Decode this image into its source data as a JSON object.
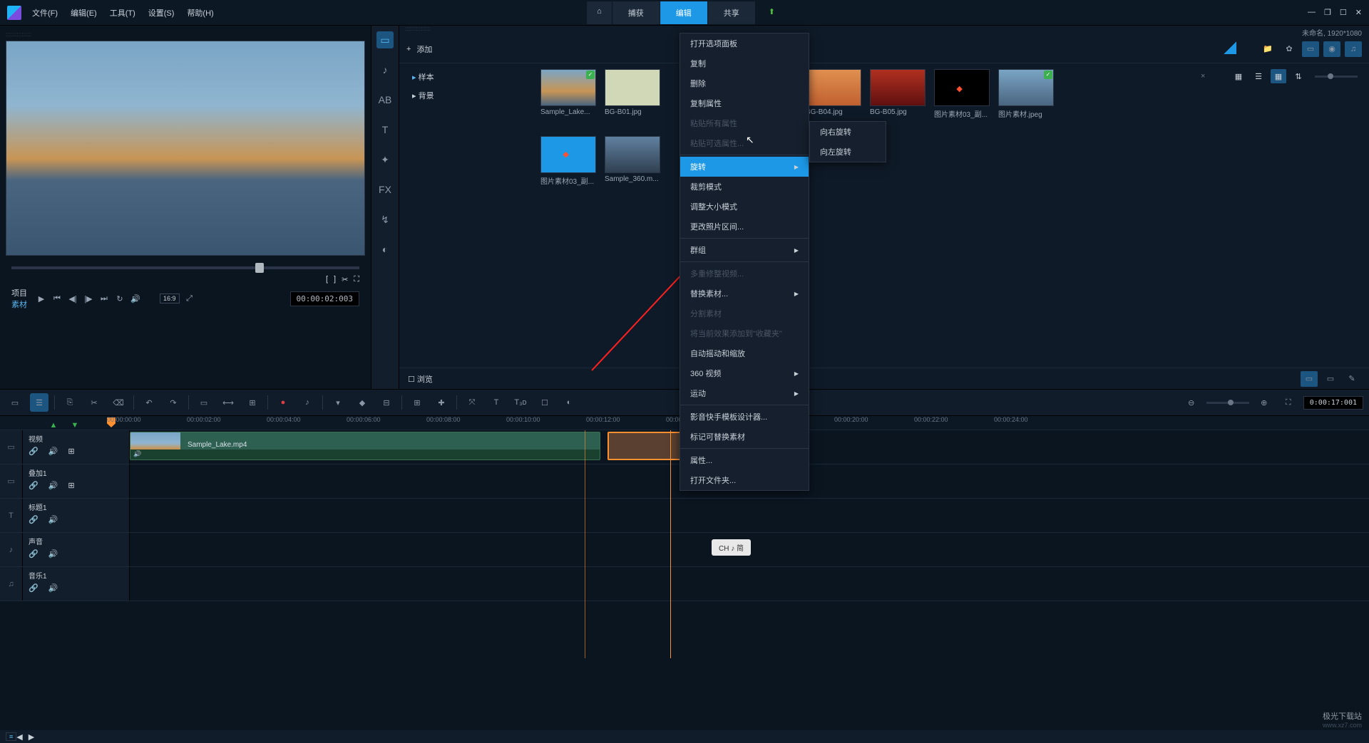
{
  "menubar": {
    "file": "文件(F)",
    "edit": "编辑(E)",
    "tools": "工具(T)",
    "settings": "设置(S)",
    "help": "帮助(H)"
  },
  "top_tabs": {
    "home": "⌂",
    "capture": "捕获",
    "edit": "编辑",
    "share": "共享"
  },
  "project_status": "未命名, 1920*1080",
  "preview": {
    "proj_label": "项目",
    "mat_label": "素材",
    "timecode": "00:00:02:003",
    "aspect": "16:9"
  },
  "library": {
    "add": "添加",
    "tree": {
      "sample": "样本",
      "bg": "背景"
    },
    "thumbs": [
      {
        "label": "Sample_Lake..."
      },
      {
        "label": "BG-B01.jpg"
      },
      {
        "label": "BG-B04.jpg"
      },
      {
        "label": "BG-B05.jpg"
      },
      {
        "label": "图片素材03_副..."
      },
      {
        "label": "图片素材.jpeg"
      },
      {
        "label": "图片素材03_副..."
      },
      {
        "label": "Sample_360.m..."
      }
    ],
    "browse": "浏览"
  },
  "context_menu": [
    {
      "label": "打开选项面板"
    },
    {
      "label": "复制"
    },
    {
      "label": "删除"
    },
    {
      "label": "复制属性"
    },
    {
      "label": "粘贴所有属性",
      "disabled": true
    },
    {
      "label": "粘贴可选属性...",
      "disabled": true
    },
    {
      "sep": true
    },
    {
      "label": "旋转",
      "arrow": true,
      "highlighted": true
    },
    {
      "label": "裁剪模式"
    },
    {
      "label": "调整大小模式"
    },
    {
      "label": "更改照片区间..."
    },
    {
      "sep": true
    },
    {
      "label": "群组",
      "arrow": true
    },
    {
      "sep": true
    },
    {
      "label": "多重修整视频...",
      "disabled": true
    },
    {
      "label": "替换素材...",
      "arrow": true
    },
    {
      "label": "分割素材",
      "disabled": true
    },
    {
      "label": "将当前效果添加到\"收藏夹\"",
      "disabled": true
    },
    {
      "label": "自动摇动和缩放"
    },
    {
      "label": "360 视频",
      "arrow": true
    },
    {
      "label": "运动",
      "arrow": true
    },
    {
      "sep": true
    },
    {
      "label": "影音快手模板设计器..."
    },
    {
      "label": "标记可替换素材"
    },
    {
      "sep": true
    },
    {
      "label": "属性..."
    },
    {
      "label": "打开文件夹..."
    }
  ],
  "submenu": [
    {
      "label": "向右旋转"
    },
    {
      "label": "向左旋转"
    }
  ],
  "toolbar_timecode": "0:00:17:001",
  "ruler_marks": [
    "00:00:00:00",
    "00:00:02:00",
    "00:00:04:00",
    "00:00:06:00",
    "00:00:08:00",
    "00:00:10:00",
    "00:00:12:00",
    "00:00:14:00",
    "00:00:20:00",
    "00:00:22:00",
    "00:00:24:00"
  ],
  "ruler_positions": [
    150,
    262,
    374,
    486,
    598,
    710,
    822,
    934,
    1170,
    1282,
    1394
  ],
  "tracks": [
    {
      "name": "视频",
      "icon": "▭"
    },
    {
      "name": "叠加1",
      "icon": "▭"
    },
    {
      "name": "标题1",
      "icon": "T"
    },
    {
      "name": "声音",
      "icon": "♪"
    },
    {
      "name": "音乐1",
      "icon": "♫"
    }
  ],
  "clip_label": "Sample_Lake.mp4",
  "ime_badge": "CH ♪ 简",
  "watermark": {
    "main": "极光下载站",
    "sub": "www.xz7.com"
  }
}
